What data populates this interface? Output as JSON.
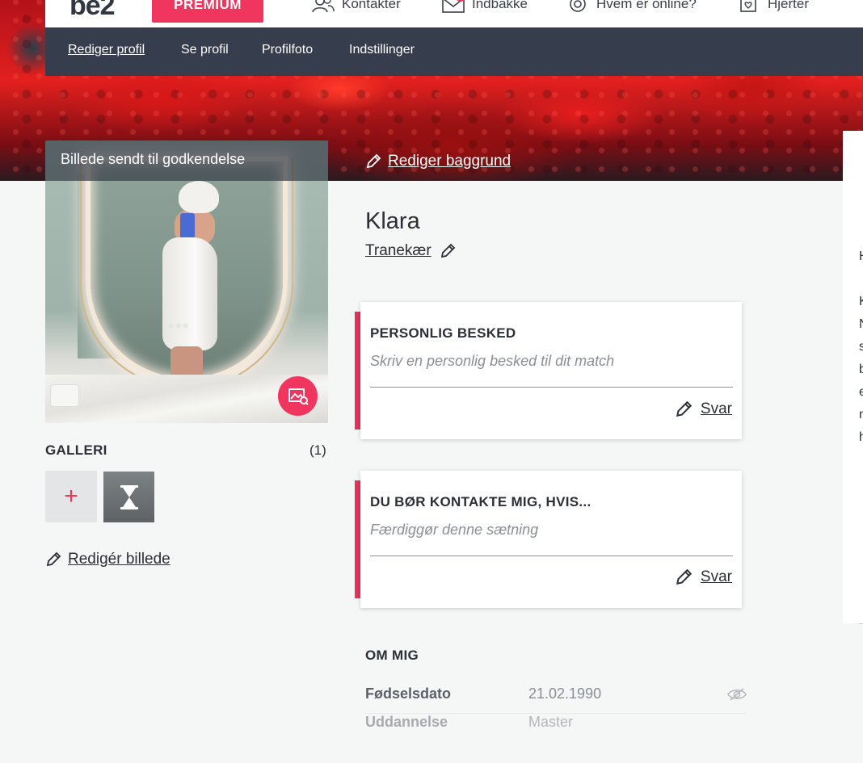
{
  "topbar": {
    "logo": "be2",
    "premium": "PREMIUM",
    "nav": [
      {
        "label": "Kontakter",
        "icon": "contacts-icon"
      },
      {
        "label": "Indbakke",
        "icon": "inbox-icon"
      },
      {
        "label": "Hvem er online?",
        "icon": "online-icon"
      },
      {
        "label": "Hjerter",
        "icon": "hearts-icon"
      }
    ]
  },
  "subnav": {
    "items": [
      "Rediger profil",
      "Se profil",
      "Profilfoto",
      "Indstillinger"
    ],
    "active": "Rediger profil"
  },
  "photo": {
    "overlay_text": "Billede sendt til godkendelse",
    "dots": "◉◉◉"
  },
  "gallery": {
    "title": "GALLERI",
    "count": "(1)",
    "add": "+",
    "edit_label": "Redigér billede"
  },
  "main": {
    "edit_background": "Rediger baggrund",
    "name": "Klara",
    "location": "Tranekær"
  },
  "cards": [
    {
      "title": "PERSONLIG BESKED",
      "hint": "Skriv en personlig besked til dit match",
      "reply": "Svar"
    },
    {
      "title": "DU BØR KONTAKTE MIG, HVIS...",
      "hint": "Færdiggør denne sætning",
      "reply": "Svar"
    }
  ],
  "about": {
    "title": "OM MIG",
    "rows": [
      {
        "label": "Fødselsdato",
        "value": "21.02.1990"
      },
      {
        "label": "Uddannelse",
        "value": "Master"
      }
    ]
  },
  "right_panel": {
    "letters": [
      "H",
      "",
      "K",
      "N",
      "s",
      "b",
      "e",
      "n",
      "h"
    ]
  },
  "colors": {
    "accent": "#f0365e",
    "subnav_bg": "#363d4d",
    "card_accent": "#e1335e"
  }
}
